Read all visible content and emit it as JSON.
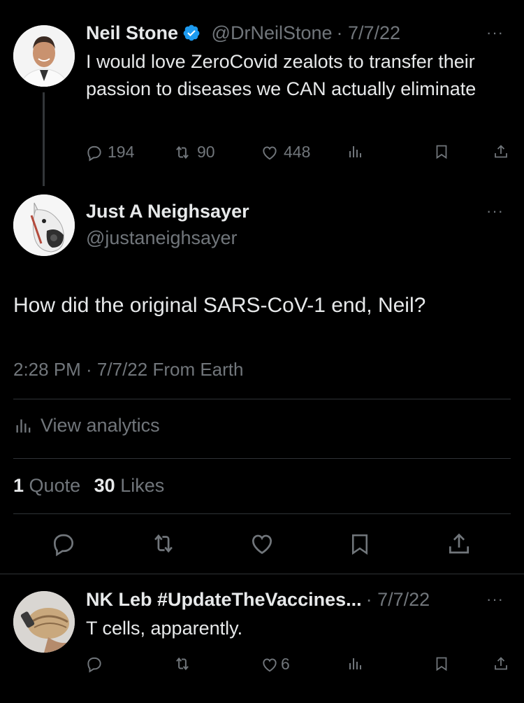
{
  "colors": {
    "background": "#000000",
    "text": "#e7e9ea",
    "muted": "#71767b",
    "divider": "#2f3336",
    "verified": "#1d9bf0"
  },
  "parent_tweet": {
    "name": "Neil Stone",
    "handle": "@DrNeilStone",
    "date": "· 7/7/22",
    "verified": true,
    "text": "I would love ZeroCovid zealots to transfer their passion to diseases we CAN actually eliminate",
    "replies": "194",
    "retweets": "90",
    "likes": "448",
    "icons": [
      "reply-icon",
      "retweet-icon",
      "like-icon",
      "analytics-icon",
      "bookmark-icon",
      "share-icon"
    ]
  },
  "main_tweet": {
    "name": "Just A Neighsayer",
    "handle": "@justaneighsayer",
    "text": "How did the original SARS-CoV-1 end, Neil?",
    "timestamp": "2:28 PM · 7/7/22 From Earth",
    "analytics_label": "View analytics",
    "quote_count": "1",
    "quote_label": "Quote",
    "likes_count": "30",
    "likes_label": "Likes"
  },
  "reply_tweet": {
    "name": "NK Leb #UpdateTheVaccines...",
    "date": "· 7/7/22",
    "text": "T cells, apparently.",
    "replies": "",
    "retweets": "",
    "likes": "6"
  },
  "more_label": "···"
}
